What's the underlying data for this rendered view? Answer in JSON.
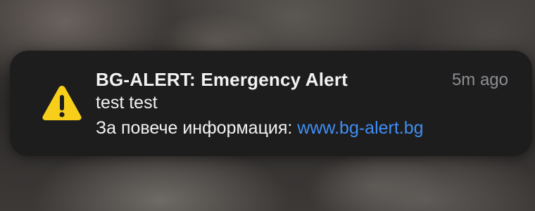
{
  "notification": {
    "icon": "warning-triangle-icon",
    "icon_color": "#f7cf1a",
    "title": "BG-ALERT: Emergency Alert",
    "time": "5m ago",
    "message": "test test",
    "more_info_label": "За повече информация:",
    "link_text": "www.bg-alert.bg",
    "link_color": "#3f8ef2"
  }
}
